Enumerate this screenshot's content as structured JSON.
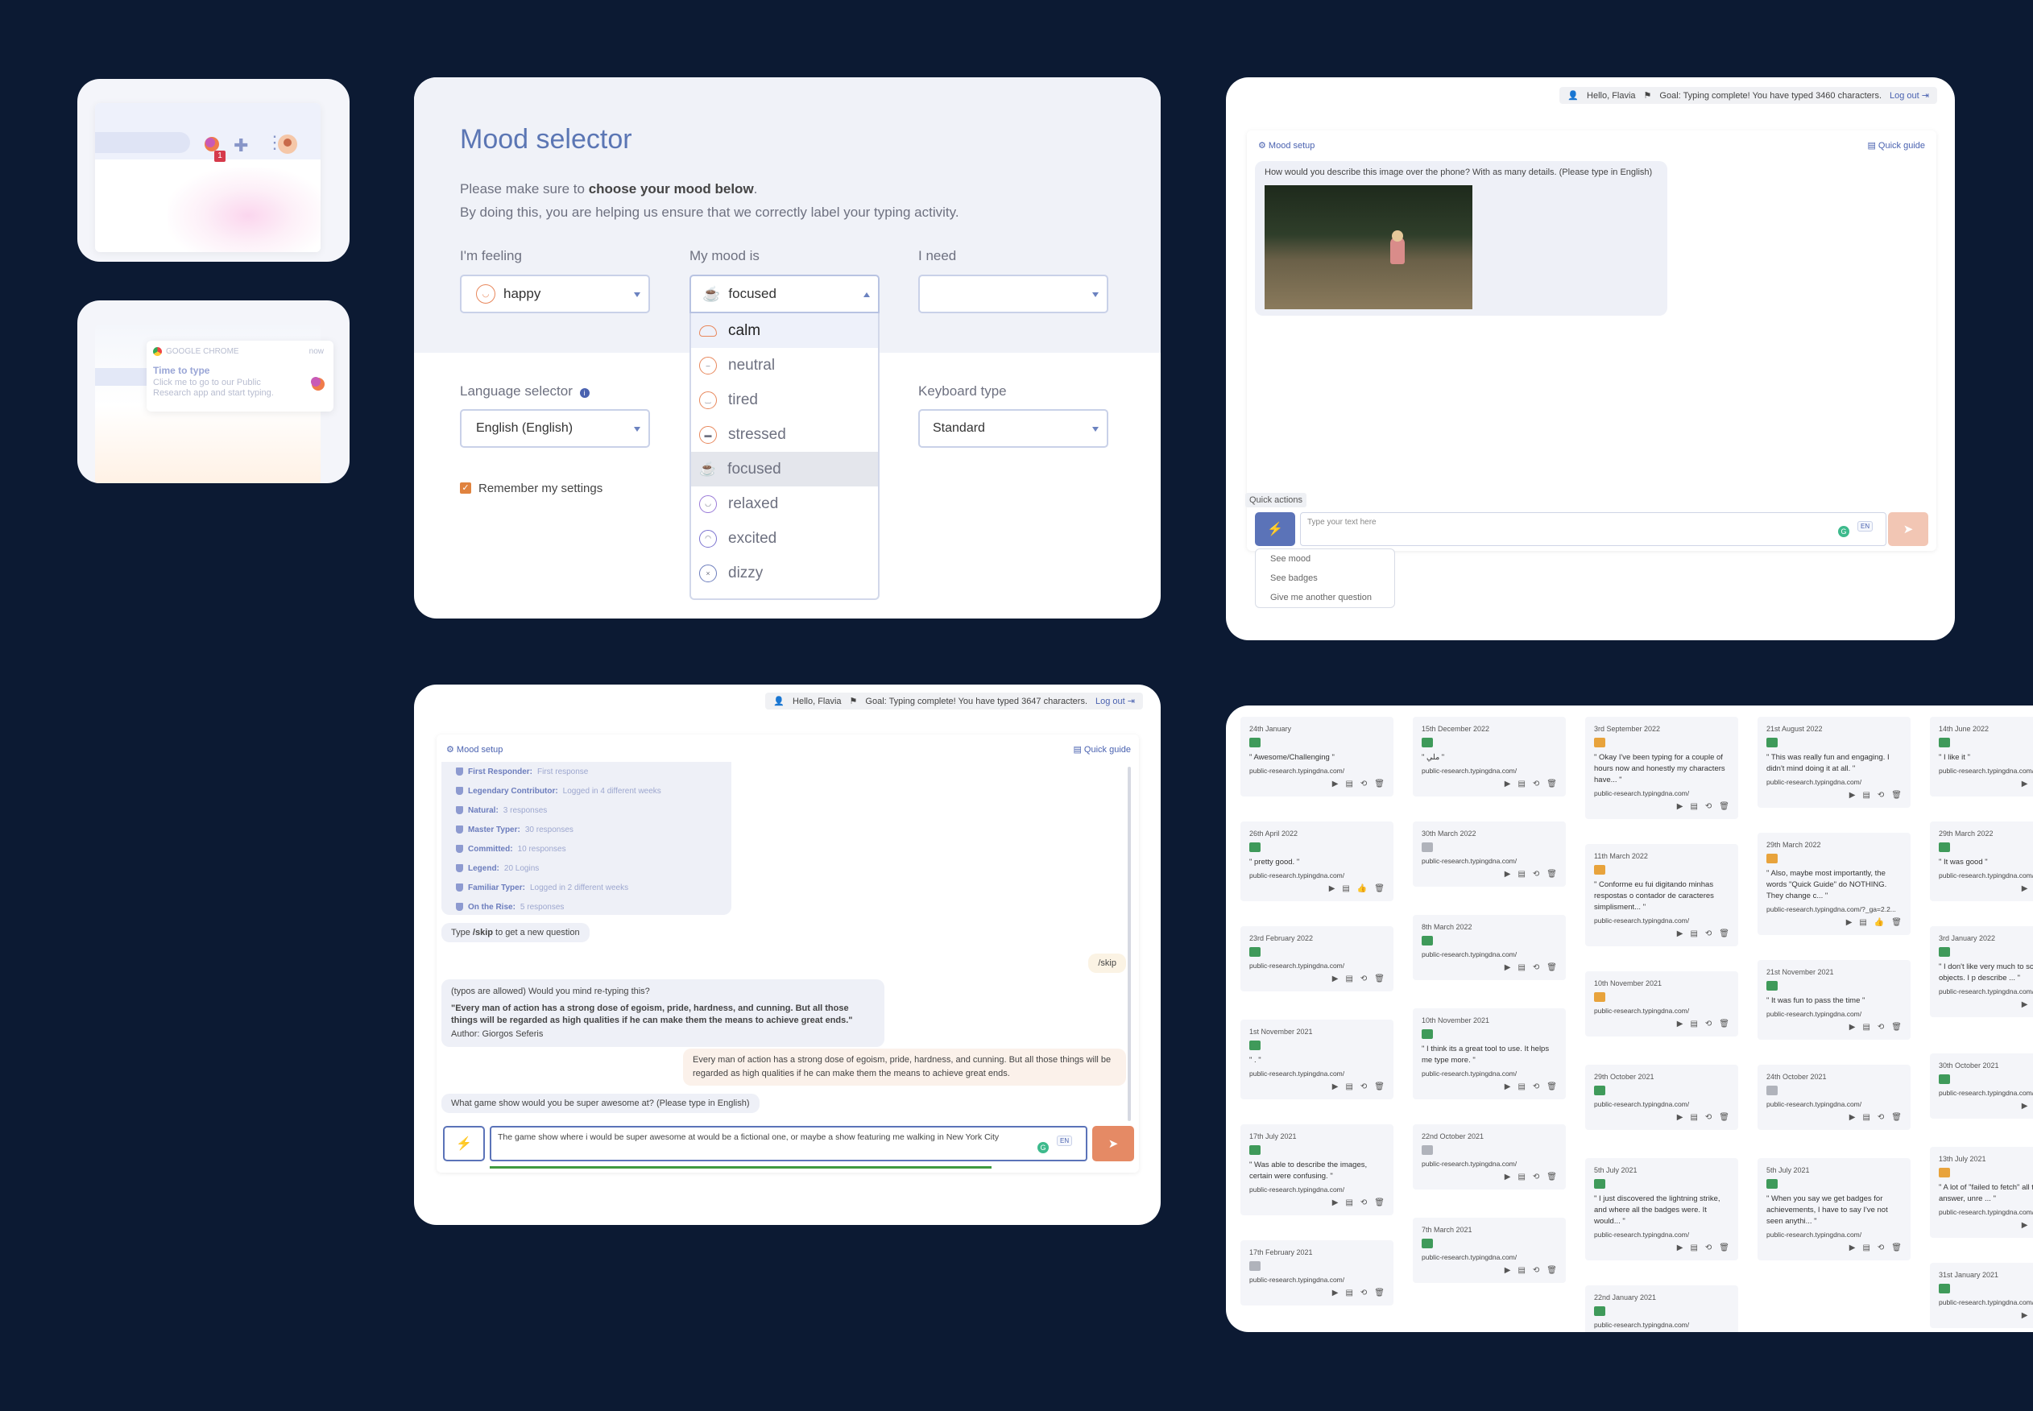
{
  "c1": {
    "badge_count": "1"
  },
  "c2": {
    "app": "GOOGLE CHROME",
    "time": "now",
    "title": "Time to type",
    "message": "Click me to go to our Public Research app and start typing."
  },
  "mood": {
    "title": "Mood selector",
    "intro_prefix": "Please make sure to ",
    "intro_bold": "choose your mood below",
    "intro_suffix": ".",
    "intro_line2": "By doing this, you are helping us ensure that we correctly label your typing activity.",
    "feeling_label": "I'm feeling",
    "feeling_value": "happy",
    "mood_label": "My mood is",
    "mood_value": "focused",
    "need_label": "I need",
    "need_value": "",
    "language_label": "Language selector",
    "language_value": "English (English)",
    "keyboard_label": "Keyboard type",
    "keyboard_value": "Standard",
    "remember_label": "Remember my settings",
    "options": [
      "calm",
      "neutral",
      "tired",
      "stressed",
      "focused",
      "relaxed",
      "excited",
      "dizzy"
    ],
    "highlighted": "calm",
    "selected": "focused"
  },
  "chat1": {
    "greeting": "Hello, Flavia",
    "goal": "Goal: Typing complete! You have typed 3460 characters.",
    "logout": "Log out",
    "mood_setup": "Mood setup",
    "quick_guide": "Quick guide",
    "question": "How would you describe this image over the phone? With as many details. (Please type in English)",
    "quick_actions": "Quick actions",
    "placeholder": "Type your text here",
    "lang": "EN",
    "menu": [
      "See mood",
      "See badges",
      "Give me another question"
    ]
  },
  "chat2": {
    "greeting": "Hello, Flavia",
    "goal": "Goal: Typing complete! You have typed 3647 characters.",
    "logout": "Log out",
    "mood_setup": "Mood setup",
    "quick_guide": "Quick guide",
    "badges": [
      {
        "name": "First Responder:",
        "desc": "First response"
      },
      {
        "name": "Legendary Contributor:",
        "desc": "Logged in 4 different weeks"
      },
      {
        "name": "Natural:",
        "desc": "3 responses"
      },
      {
        "name": "Master Typer:",
        "desc": "30 responses"
      },
      {
        "name": "Committed:",
        "desc": "10 responses"
      },
      {
        "name": "Legend:",
        "desc": "20 Logins"
      },
      {
        "name": "Familiar Typer:",
        "desc": "Logged in 2 different weeks"
      },
      {
        "name": "On the Rise:",
        "desc": "5 responses"
      }
    ],
    "skip_prefix": "Type ",
    "skip_cmd": "/skip",
    "skip_suffix": " to get a new question",
    "user_skip": "/skip",
    "retype_intro": "(typos are allowed) Would you mind re-typing this?",
    "quote": "\"Every man of action has a strong dose of egoism, pride, hardness, and cunning. But all those things will be regarded as high qualities if he can make them the means to achieve great ends.\"",
    "author": "Author: Giorgos Seferis",
    "user_reply": "Every man of action has a strong dose of egoism, pride, hardness, and cunning. But all those things will be regarded as high qualities if he can make them the means to achieve great ends.",
    "question": "What game show would you be super awesome at? (Please type in English)",
    "input_value": "The game show where i would be super awesome at would be a fictional one, or maybe a show featuring me walking in New York City",
    "lang": "EN",
    "progress": 0.84
  },
  "grid": {
    "url": "public-research.typingdna.com/",
    "url_long": "public-research.typingdna.com/?_ga=2.2...",
    "cols": [
      [
        {
          "date": "24th January",
          "q": "\" Awesome/Challenging \"",
          "c": "#3f9a5a"
        },
        {
          "date": "26th April 2022",
          "q": "\" pretty good. \"",
          "c": "#3f9a5a",
          "like": true
        },
        {
          "date": "23rd February 2022",
          "q": "",
          "c": "#3f9a5a"
        },
        {
          "date": "1st November 2021",
          "q": "\" . \"",
          "c": "#3f9a5a"
        },
        {
          "date": "17th July 2021",
          "q": "\" Was able to describe the images, certain were confusing. \"",
          "c": "#3f9a5a"
        },
        {
          "date": "17th February 2021",
          "q": "",
          "c": "#b0b3bb"
        }
      ],
      [
        {
          "date": "15th December 2022",
          "q": "\" ملي \"",
          "c": "#3f9a5a"
        },
        {
          "date": "30th March 2022",
          "q": "",
          "c": "#b0b3bb"
        },
        {
          "date": "8th March 2022",
          "q": "",
          "c": "#3f9a5a"
        },
        {
          "date": "10th November 2021",
          "q": "\" I think its a great tool to use. It helps me type more. \"",
          "c": "#3f9a5a"
        },
        {
          "date": "22nd October 2021",
          "q": "",
          "c": "#b0b3bb"
        },
        {
          "date": "7th March 2021",
          "q": "",
          "c": "#3f9a5a"
        }
      ],
      [
        {
          "date": "3rd September 2022",
          "q": "\" Okay I've been typing for a couple of hours now and honestly my characters have... \"",
          "c": "#e8a33c"
        },
        {
          "date": "11th March 2022",
          "q": "\" Conforme eu fui digitando minhas respostas o contador de caracteres simplisment... \"",
          "c": "#e8a33c"
        },
        {
          "date": "10th November 2021",
          "q": "",
          "c": "#e8a33c"
        },
        {
          "date": "29th October 2021",
          "q": "",
          "c": "#3f9a5a"
        },
        {
          "date": "5th July 2021",
          "q": "\" I just discovered the lightning strike, and where all the badges were. It would... \"",
          "c": "#3f9a5a"
        },
        {
          "date": "22nd January 2021",
          "q": "",
          "c": "#3f9a5a"
        }
      ],
      [
        {
          "date": "21st August 2022",
          "q": "\" This was really fun and engaging. I didn't mind doing it at all. \"",
          "c": "#3f9a5a"
        },
        {
          "date": "29th March 2022",
          "q": "\" Also, maybe most importantly, the words \"Quick Guide\" do NOTHING. They change c... \"",
          "c": "#e8a33c",
          "long": true,
          "like": true
        },
        {
          "date": "21st November 2021",
          "q": "\" It was fun to pass the time \"",
          "c": "#3f9a5a"
        },
        {
          "date": "24th October 2021",
          "q": "",
          "c": "#b0b3bb"
        },
        {
          "date": "5th July 2021",
          "q": "\" When you say we get badges for achievements, I have to say I've not seen anythi... \"",
          "c": "#3f9a5a"
        }
      ],
      [
        {
          "date": "14th June 2022",
          "q": "\" I like it \"",
          "c": "#3f9a5a"
        },
        {
          "date": "29th March 2022",
          "q": "\" It was good \"",
          "c": "#3f9a5a"
        },
        {
          "date": "3rd January 2022",
          "q": "\" I don't like very much to scenarios and objects. I p describe ... \"",
          "c": "#3f9a5a"
        },
        {
          "date": "30th October 2021",
          "q": "",
          "c": "#3f9a5a"
        },
        {
          "date": "13th July 2021",
          "q": "\" A lot of \"failed to fetch\" all the typed answer, unre ... \"",
          "c": "#e8a33c"
        },
        {
          "date": "31st January 2021",
          "q": "",
          "c": "#3f9a5a"
        }
      ]
    ]
  }
}
